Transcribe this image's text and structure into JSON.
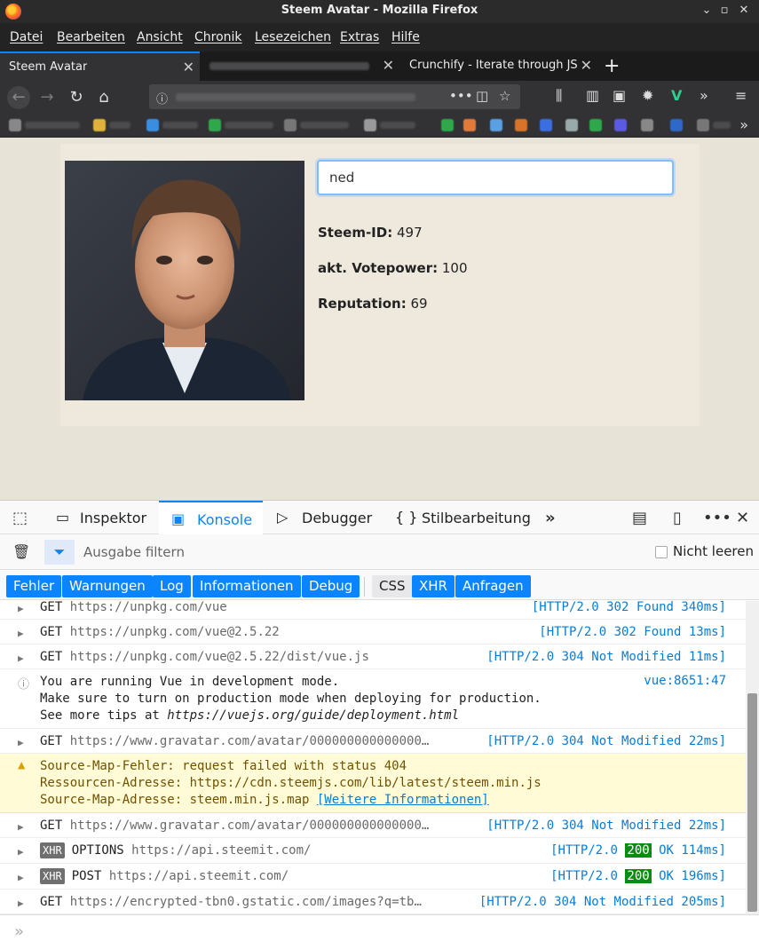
{
  "window": {
    "title": "Steem Avatar - Mozilla Firefox"
  },
  "menu": [
    "Datei",
    "Bearbeiten",
    "Ansicht",
    "Chronik",
    "Lesezeichen",
    "Extras",
    "Hilfe"
  ],
  "tabs": [
    {
      "label": "Steem Avatar",
      "active": true
    },
    {
      "label": "",
      "active": false
    },
    {
      "label": "Crunchify - Iterate through JSON",
      "active": false
    }
  ],
  "page": {
    "search": {
      "value": "ned"
    },
    "stats": [
      {
        "label": "Steem-ID:",
        "value": "497"
      },
      {
        "label": "akt. Votepower:",
        "value": "100"
      },
      {
        "label": "Reputation:",
        "value": "69"
      }
    ]
  },
  "devtools": {
    "tabs": [
      "Inspektor",
      "Konsole",
      "Debugger",
      "Stilbearbeitung"
    ],
    "active_tab": "Konsole",
    "filter_placeholder": "Ausgabe filtern",
    "persist_label": "Nicht leeren",
    "levels": [
      {
        "label": "Fehler",
        "on": true
      },
      {
        "label": "Warnungen",
        "on": true
      },
      {
        "label": "Log",
        "on": true
      },
      {
        "label": "Informationen",
        "on": true
      },
      {
        "label": "Debug",
        "on": true
      },
      {
        "label": "CSS",
        "on": false
      },
      {
        "label": "XHR",
        "on": true
      },
      {
        "label": "Anfragen",
        "on": true
      }
    ]
  },
  "console": [
    {
      "method": "GET",
      "url": "https://unpkg.com/vue",
      "meta": "[HTTP/2.0 302 Found 340ms]"
    },
    {
      "method": "GET",
      "url": "https://unpkg.com/vue@2.5.22",
      "meta": "[HTTP/2.0 302 Found 13ms]"
    },
    {
      "method": "GET",
      "url": "https://unpkg.com/vue@2.5.22/dist/vue.js",
      "meta": "[HTTP/2.0 304 Not Modified 11ms]"
    },
    {
      "lines": [
        "You are running Vue in development mode.",
        "Make sure to turn on production mode when deploying for production.",
        "See more tips at "
      ],
      "link": "https://vuejs.org/guide/deployment.html",
      "meta": "vue:8651:47"
    },
    {
      "method": "GET",
      "url": "https://www.gravatar.com/avatar/000000000000000…",
      "meta": "[HTTP/2.0 304 Not Modified 22ms]"
    },
    {
      "warn": [
        "Source-Map-Fehler: request failed with status 404",
        "Ressourcen-Adresse: https://cdn.steemjs.com/lib/latest/steem.min.js",
        "Source-Map-Adresse: steem.min.js.map "
      ],
      "link": "[Weitere Informationen]"
    },
    {
      "method": "GET",
      "url": "https://www.gravatar.com/avatar/000000000000000…",
      "meta": "[HTTP/2.0 304 Not Modified 22ms]"
    },
    {
      "badge": "XHR",
      "method": "OPTIONS",
      "url": "https://api.steemit.com/",
      "meta_pre": "[HTTP/2.0 ",
      "status": "200",
      "meta_post": " OK 114ms]"
    },
    {
      "badge": "XHR",
      "method": "POST",
      "url": "https://api.steemit.com/",
      "meta_pre": "[HTTP/2.0 ",
      "status": "200",
      "meta_post": " OK 196ms]"
    },
    {
      "method": "GET",
      "url": "https://encrypted-tbn0.gstatic.com/images?q=tb…",
      "meta": "[HTTP/2.0 304 Not Modified 205ms]"
    }
  ]
}
